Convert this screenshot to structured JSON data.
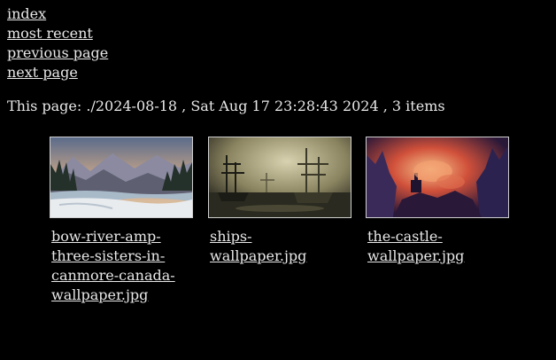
{
  "nav": {
    "index": "index",
    "most_recent": "most recent",
    "previous_page": "previous page",
    "next_page": "next page"
  },
  "page_info": "This page: ./2024-08-18 , Sat Aug 17 23:28:43 2024 , 3 items",
  "items": [
    {
      "caption": "bow-river-amp-three-sisters-in-canmore-canada-wallpaper.jpg"
    },
    {
      "caption": "ships-wallpaper.jpg"
    },
    {
      "caption": "the-castle-wallpaper.jpg"
    }
  ],
  "colors": {
    "background": "#000000",
    "text": "#e8e8e8",
    "thumb_border": "#cfcfcf"
  }
}
